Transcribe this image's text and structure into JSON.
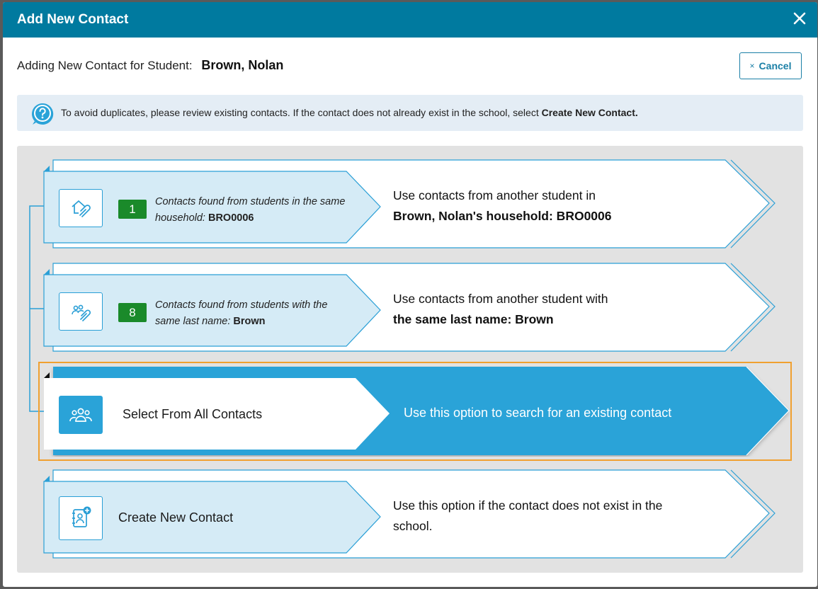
{
  "modal": {
    "title": "Add New Contact",
    "close_icon": "close-icon"
  },
  "student_row": {
    "label": "Adding New Contact for Student:",
    "student_name": "Brown, Nolan"
  },
  "cancel_button": {
    "icon": "×",
    "label": "Cancel"
  },
  "info": {
    "icon": "help-icon",
    "text": "To avoid duplicates, please review existing contacts. If the contact does not already exist in the school, select ",
    "bold": "Create New Contact."
  },
  "options": {
    "household": {
      "icon": "house-link-icon",
      "count": "1",
      "found_text": "Contacts found from students in the same household:",
      "found_code": "BRO0006",
      "desc_line1": "Use contacts from another student in",
      "desc_line2": "Brown, Nolan's household: BRO0006"
    },
    "last_name": {
      "icon": "people-link-icon",
      "count": "8",
      "found_text": "Contacts found from students with the same last name:",
      "found_code": "Brown",
      "desc_line1": "Use contacts from another student with",
      "desc_line2": "the same last name: Brown"
    },
    "all_contacts": {
      "icon": "group-icon",
      "label": "Select From All Contacts",
      "desc": "Use this option to search for an existing contact"
    },
    "create": {
      "icon": "add-contact-icon",
      "label": "Create New Contact",
      "desc": "Use this option if the contact does not exist in the school."
    }
  },
  "colors": {
    "header": "#007a9f",
    "accent": "#2aa3d8",
    "light_panel": "#d5ebf6",
    "badge": "#1a8a2a",
    "selection_outline": "#f0a030"
  }
}
